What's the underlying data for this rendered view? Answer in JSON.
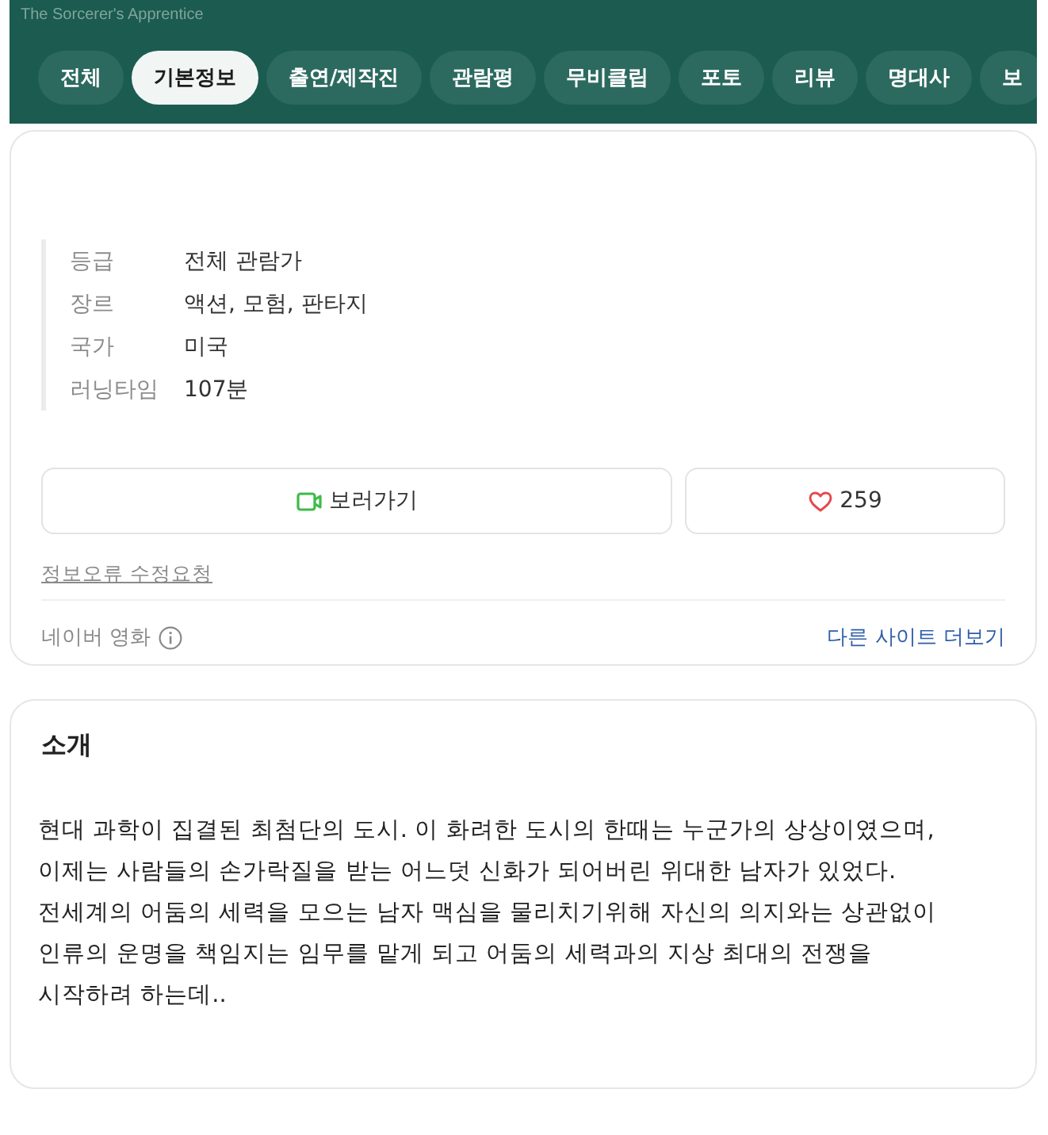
{
  "header": {
    "title": "The Sorcerer's Apprentice",
    "tabs": [
      {
        "label": "전체",
        "selected": false
      },
      {
        "label": "기본정보",
        "selected": true
      },
      {
        "label": "출연/제작진",
        "selected": false
      },
      {
        "label": "관람평",
        "selected": false
      },
      {
        "label": "무비클립",
        "selected": false
      },
      {
        "label": "포토",
        "selected": false
      },
      {
        "label": "리뷰",
        "selected": false
      },
      {
        "label": "명대사",
        "selected": false
      },
      {
        "label": "보",
        "selected": false
      }
    ]
  },
  "info": {
    "rows": [
      {
        "label": "등급",
        "value": "전체 관람가"
      },
      {
        "label": "장르",
        "value": "액션, 모험, 판타지"
      },
      {
        "label": "국가",
        "value": "미국"
      },
      {
        "label": "러닝타임",
        "value": "107분"
      }
    ],
    "watch_button": "보러가기",
    "like_count": "259",
    "report_link": "정보오류 수정요청",
    "source_label": "네이버 영화",
    "more_link": "다른 사이트 더보기"
  },
  "intro": {
    "heading": "소개",
    "text": "현대 과학이 집결된 최첨단의 도시. 이 화려한 도시의 한때는 누군가의 상상이였으며,\n이제는 사람들의 손가락질을 받는 어느덧 신화가 되어버린 위대한 남자가 있었다.\n전세계의 어둠의 세력을 모으는 남자 맥심을 물리치기위해 자신의 의지와는 상관없이\n인류의 운명을 책임지는 임무를 맡게 되고 어둠의 세력과의 지상 최대의 전쟁을\n시작하려 하는데.."
  }
}
